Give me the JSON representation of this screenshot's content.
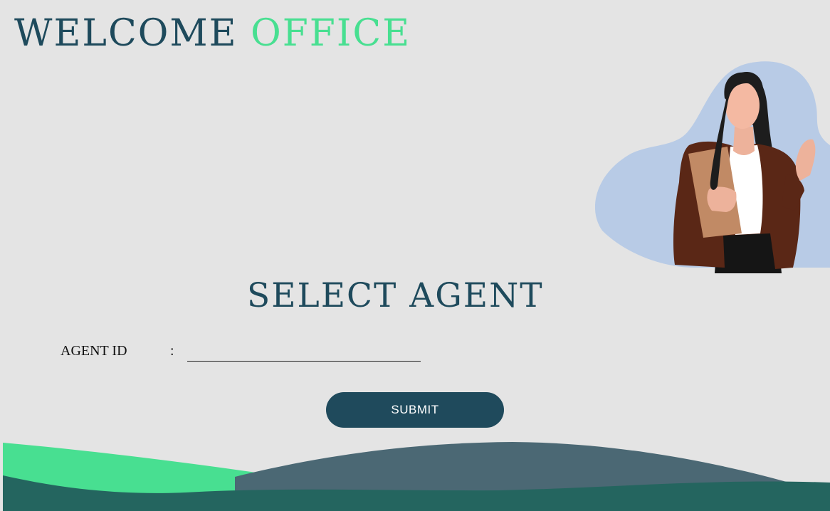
{
  "header": {
    "title_part1": "WELCOME",
    "title_part2": "OFFICE"
  },
  "illustration": {
    "icon": "office-woman-waving-illustration",
    "blob_color": "#b8cbe6"
  },
  "form": {
    "heading": "SELECT AGENT",
    "agent_id_label": "AGENT ID",
    "separator": ":",
    "agent_id_value": "",
    "agent_id_placeholder": ""
  },
  "actions": {
    "submit_label": "SUBMIT"
  },
  "colors": {
    "primary": "#1f4a5c",
    "accent": "#48df91",
    "background": "#e4e4e4",
    "wave_slate": "#4b6874",
    "wave_teal": "#24655f"
  }
}
